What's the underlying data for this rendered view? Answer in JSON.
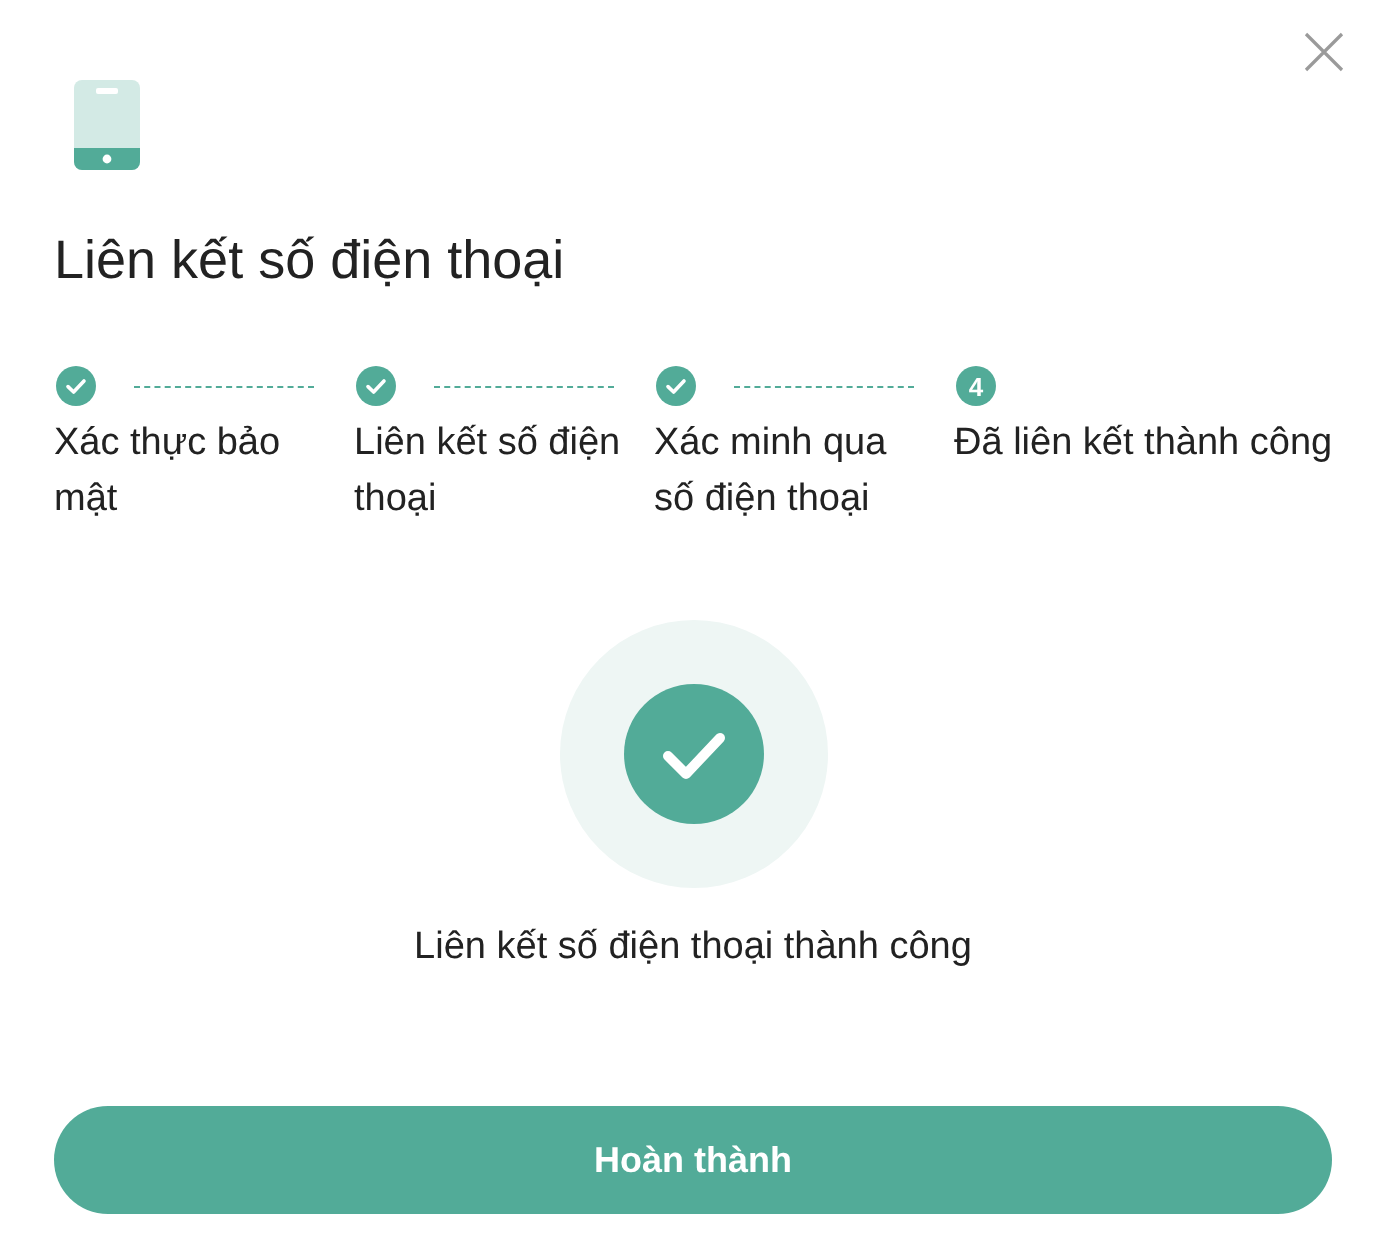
{
  "dialog": {
    "title": "Liên kết số điện thoại"
  },
  "steps": [
    {
      "label": "Xác thực bảo mật",
      "completed": true
    },
    {
      "label": "Liên kết số điện thoại",
      "completed": true
    },
    {
      "label": "Xác minh qua số điện thoại",
      "completed": true
    },
    {
      "label": "Đã liên kết thành công",
      "completed": false,
      "number": "4"
    }
  ],
  "result": {
    "message": "Liên kết số điện thoại thành công"
  },
  "buttons": [
    {
      "label": "Hoàn thành"
    }
  ]
}
